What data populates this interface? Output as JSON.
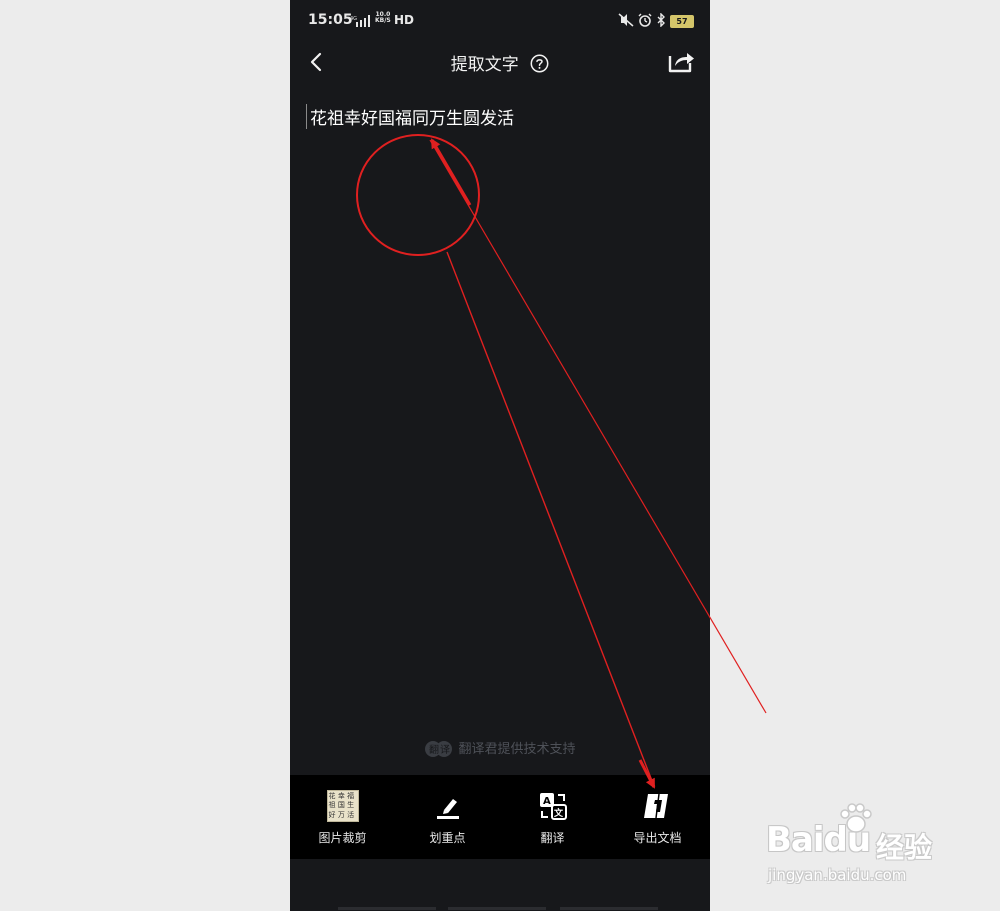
{
  "status_bar": {
    "time": "15:05",
    "network_type": "4G",
    "net_speed_value": "10.0",
    "net_speed_unit": "KB/S",
    "hd": "HD",
    "battery": "57"
  },
  "header": {
    "title": "提取文字",
    "help_icon": "question-circle-icon",
    "back_icon": "chevron-left-icon",
    "share_icon": "share-export-icon"
  },
  "content": {
    "extracted_text": "花祖幸好国福同万生圆发活"
  },
  "credit": {
    "text": "翻译君提供技术支持"
  },
  "toolbar": {
    "items": [
      {
        "label": "图片裁剪",
        "icon": "image-thumbnail-icon"
      },
      {
        "label": "划重点",
        "icon": "highlighter-icon"
      },
      {
        "label": "翻译",
        "icon": "translate-icon"
      },
      {
        "label": "导出文档",
        "icon": "export-document-icon"
      }
    ]
  },
  "annotation_color": "#e02020",
  "watermark": {
    "brand": "Bai",
    "brand_suffix": "du",
    "brand_cn": "经验",
    "url": "jingyan.baidu.com"
  }
}
